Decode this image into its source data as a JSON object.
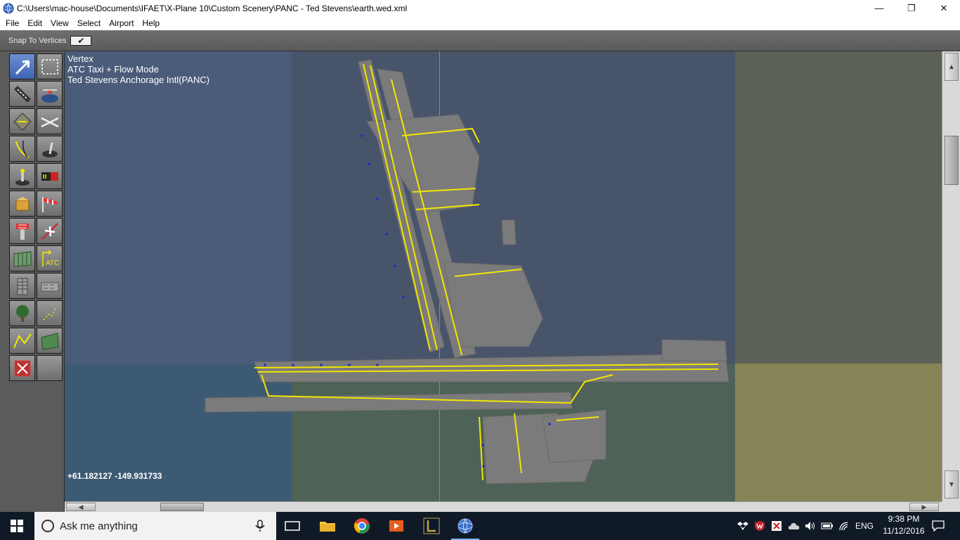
{
  "window": {
    "title": "C:\\Users\\mac-house\\Documents\\IFAET\\X-Plane 10\\Custom Scenery\\PANC - Ted Stevens\\earth.wed.xml",
    "minimize_glyph": "—",
    "restore_glyph": "❐",
    "close_glyph": "✕"
  },
  "menu": [
    "File",
    "Edit",
    "View",
    "Select",
    "Airport",
    "Help"
  ],
  "options": {
    "snap_label": "Snap To Vertices",
    "snap_checked": true,
    "check_glyph": "✔"
  },
  "tools": [
    {
      "name": "vertex-tool",
      "icon": "arrow-icon",
      "active": true
    },
    {
      "name": "marquee-tool",
      "icon": "marquee-icon"
    },
    {
      "name": "runway-tool",
      "icon": "runway-icon"
    },
    {
      "name": "helipad-tool",
      "icon": "helipad-icon"
    },
    {
      "name": "taxiway-tool",
      "icon": "taxiway-icon"
    },
    {
      "name": "boundary-tool",
      "icon": "boundary-icon"
    },
    {
      "name": "taxiline-tool",
      "icon": "taxiline-icon"
    },
    {
      "name": "light-fixture-tool",
      "icon": "light-fixture-icon"
    },
    {
      "name": "lights-tool",
      "icon": "lights-icon"
    },
    {
      "name": "sign-tool",
      "icon": "sign-icon"
    },
    {
      "name": "object-tool",
      "icon": "object-icon"
    },
    {
      "name": "windsock-tool",
      "icon": "windsock-icon"
    },
    {
      "name": "tower-tool",
      "icon": "tower-icon"
    },
    {
      "name": "ramp-start-tool",
      "icon": "ramp-start-icon"
    },
    {
      "name": "facade-tool",
      "icon": "facade-icon"
    },
    {
      "name": "atc-tool",
      "icon": "atc-icon",
      "label": "ATC"
    },
    {
      "name": "building-tool",
      "icon": "building-icon"
    },
    {
      "name": "string-tool",
      "icon": "string-icon"
    },
    {
      "name": "forest-tool",
      "icon": "tree-icon"
    },
    {
      "name": "point-tool",
      "icon": "points-icon"
    },
    {
      "name": "line-tool",
      "icon": "line-icon"
    },
    {
      "name": "polygon-tool",
      "icon": "polygon-icon"
    },
    {
      "name": "exclusion-tool",
      "icon": "exclusion-icon"
    },
    {
      "name": "empty-tool",
      "icon": "blank-icon"
    }
  ],
  "map": {
    "mode_line1": "Vertex",
    "mode_line2": "ATC Taxi + Flow Mode",
    "mode_line3": "Ted Stevens Anchorage Intl(PANC)",
    "coordinates": "+61.182127 -149.931733"
  },
  "taskbar": {
    "search_placeholder": "Ask me anything",
    "language": "ENG",
    "time": "9:38 PM",
    "date": "11/12/2016",
    "pinned": [
      "task-view-icon",
      "file-explorer-icon",
      "chrome-icon",
      "media-player-icon",
      "league-icon",
      "wed-globe-icon"
    ]
  },
  "colors": {
    "accent": "#3f64b5",
    "taxiline": "#f2e600",
    "pavement": "#7b7b7b",
    "taskbar": "#101a26"
  }
}
